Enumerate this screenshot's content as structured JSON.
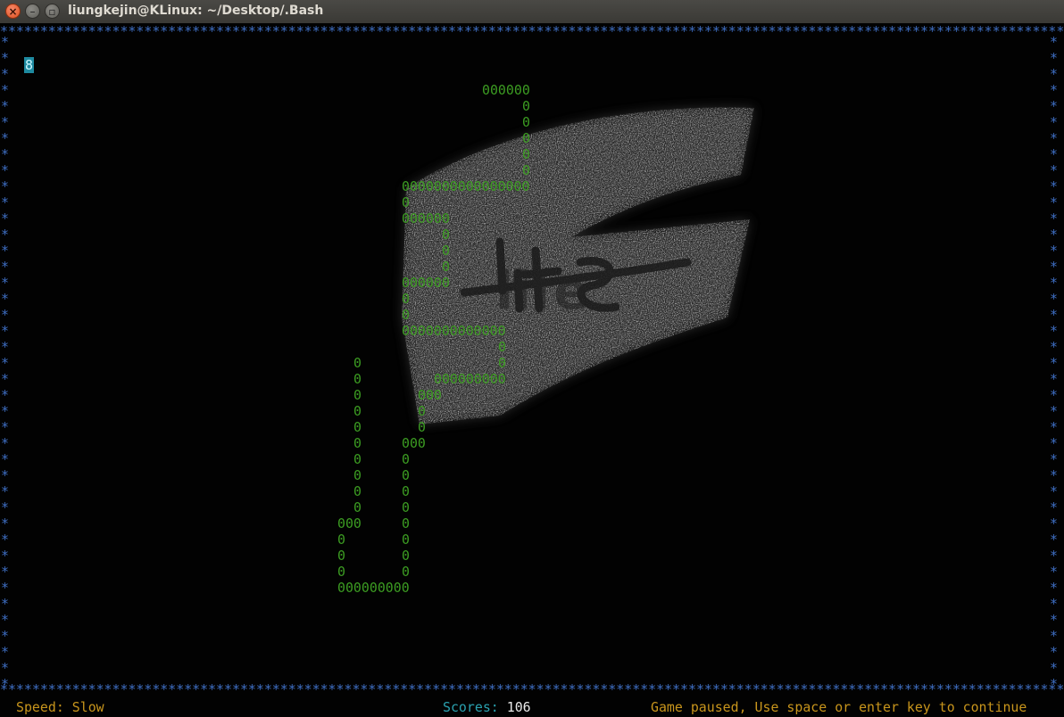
{
  "window": {
    "title": "liungkejin@KLinux: ~/Desktop/.Bash"
  },
  "game": {
    "border_char": "*",
    "snake_head": "8",
    "snake_body_char": "0",
    "speed_label": "Speed:",
    "speed_value": "Slow",
    "scores_label": "Scores:",
    "scores_value": "106",
    "pause_message": "Game paused, Use space or enter key to continue"
  },
  "background_image": {
    "text": "life"
  },
  "colors": {
    "border": "#3f6fc4",
    "snake": "#3c9c22",
    "head_bg": "#1e8aa0",
    "status_amber": "#c8951c",
    "status_cyan": "#2aa2b0"
  }
}
